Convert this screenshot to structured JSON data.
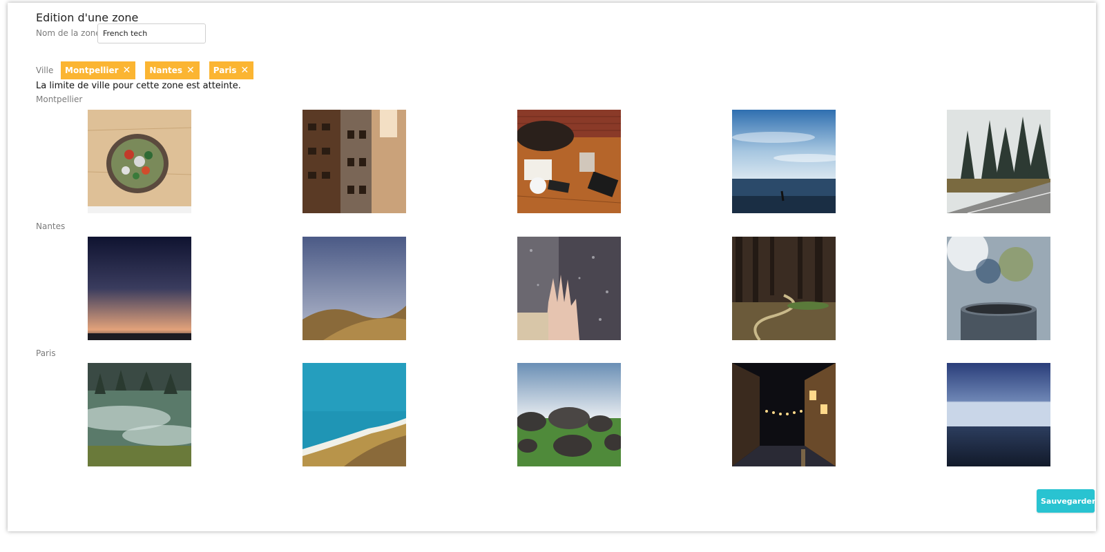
{
  "page": {
    "title": "Edition d'une zone"
  },
  "form": {
    "zone_name_label": "Nom de la zone",
    "zone_name_value": "French tech",
    "city_label": "Ville",
    "city_limit_message": "La limite de ville pour cette zone est atteinte."
  },
  "tags": [
    {
      "label": "Montpellier",
      "remove_icon": "close-icon"
    },
    {
      "label": "Nantes",
      "remove_icon": "close-icon"
    },
    {
      "label": "Paris",
      "remove_icon": "close-icon"
    }
  ],
  "cities": [
    {
      "name": "Montpellier",
      "photos": [
        "salad-bowl",
        "city-buildings",
        "table-meeting",
        "ocean-sky",
        "forest-road"
      ]
    },
    {
      "name": "Nantes",
      "photos": [
        "dusk-sky",
        "dry-hills",
        "rainy-window-hand",
        "forest-path",
        "steaming-cup"
      ]
    },
    {
      "name": "Paris",
      "photos": [
        "misty-forest",
        "aerial-coast",
        "boulders-field",
        "night-street",
        "calm-sea"
      ]
    }
  ],
  "actions": {
    "save_label": "Sauvegarder"
  },
  "colors": {
    "tag_background": "#fbb532",
    "save_button": "#29c3d1"
  }
}
